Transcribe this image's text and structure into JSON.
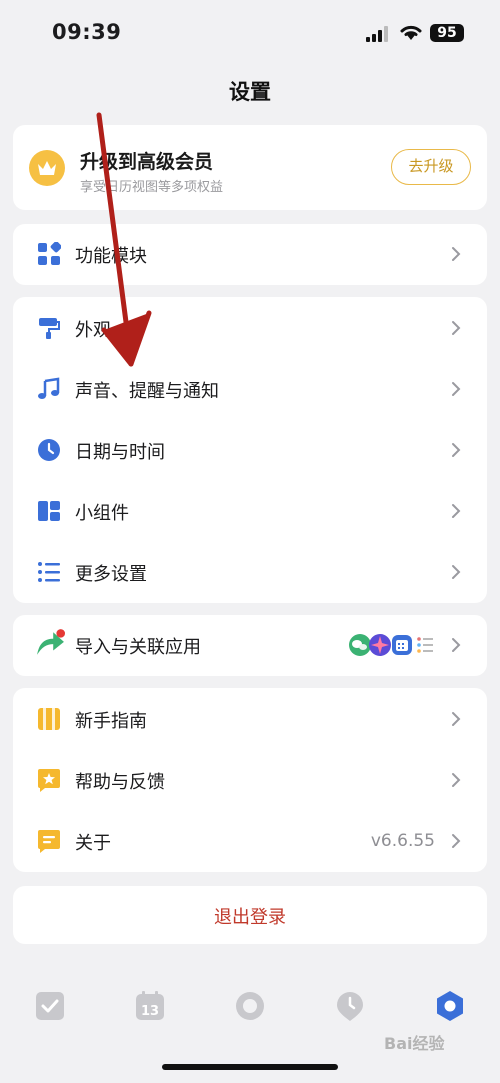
{
  "status_bar": {
    "time": "09:39",
    "battery": "95"
  },
  "nav": {
    "title": "设置"
  },
  "premium": {
    "title": "升级到高级会员",
    "subtitle": "享受日历视图等多项权益",
    "button": "去升级"
  },
  "rows": {
    "modules": "功能模块",
    "appearance": "外观",
    "sound": "声音、提醒与通知",
    "datetime": "日期与时间",
    "widgets": "小组件",
    "more": "更多设置",
    "import": "导入与关联应用",
    "guide": "新手指南",
    "help": "帮助与反馈",
    "about": "关于",
    "about_version": "v6.6.55"
  },
  "logout": "退出登录",
  "watermark": "Bai经验",
  "icons": {
    "modules": "grid-icon",
    "appearance": "paint-roller-icon",
    "sound": "music-note-icon",
    "datetime": "clock-icon",
    "widgets": "widgets-icon",
    "more": "list-icon",
    "import": "share-arrow-icon",
    "guide": "book-icon",
    "help": "star-message-icon",
    "about": "info-message-icon"
  },
  "colors": {
    "accent": "#3b6fd8",
    "gold": "#e9b949",
    "danger": "#c0392b",
    "green": "#3bb273",
    "annotation_arrow": "#b0201a"
  }
}
